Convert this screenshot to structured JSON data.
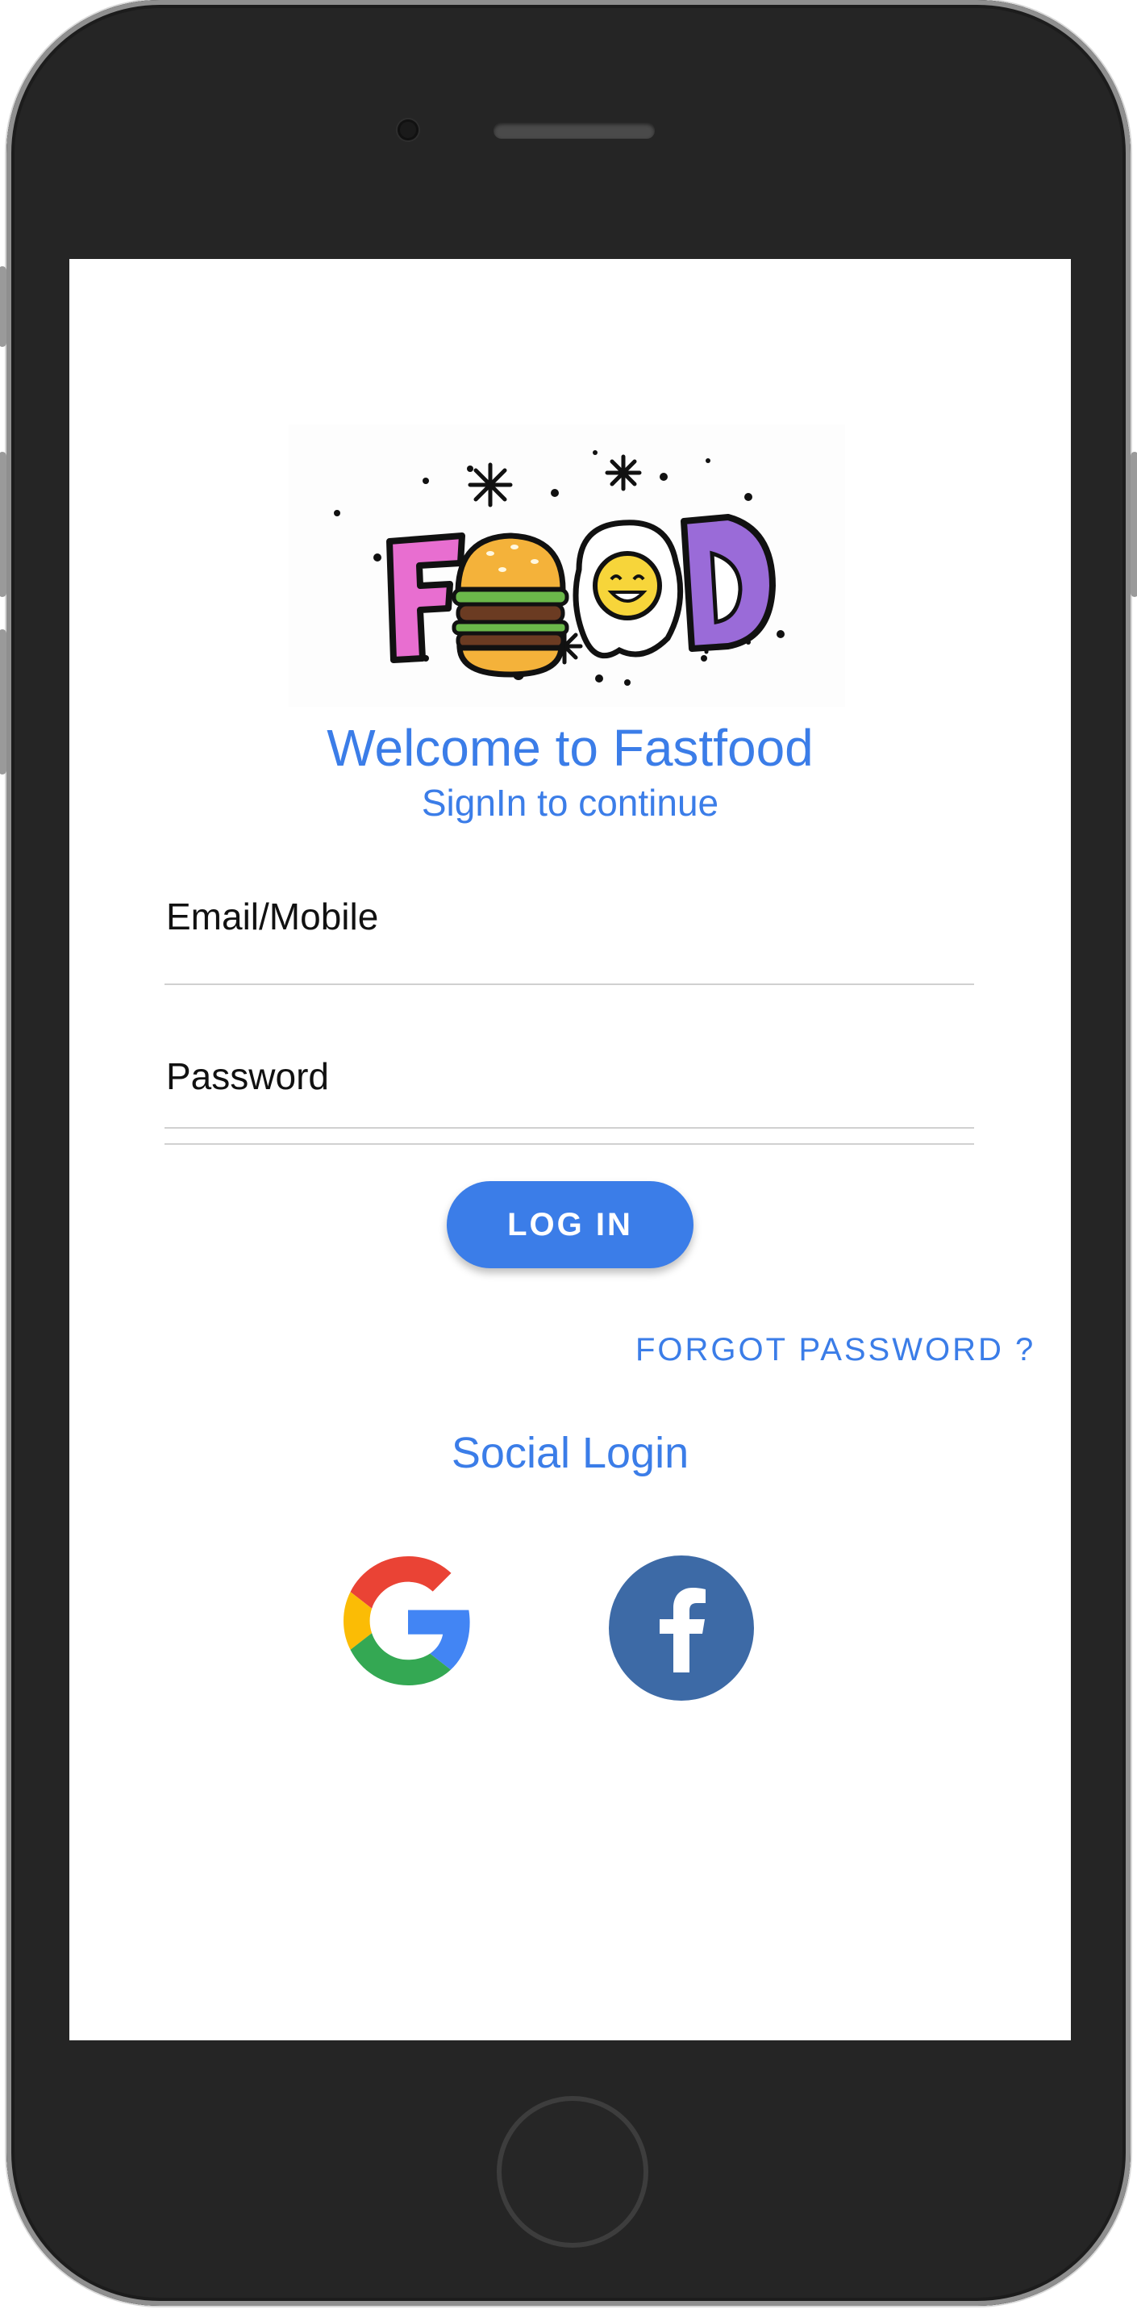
{
  "app": {
    "logo_text": "FOOD",
    "welcome": "Welcome to Fastfood",
    "subtitle": "SignIn to continue"
  },
  "form": {
    "email_label": "Email/Mobile",
    "password_label": "Password",
    "login_button": "LOG IN",
    "forgot_link": "FORGOT PASSWORD ?"
  },
  "social": {
    "title": "Social Login",
    "google_icon": "google-icon",
    "facebook_icon": "facebook-icon"
  },
  "colors": {
    "accent": "#3b7de8",
    "facebook": "#3d6aa6"
  }
}
